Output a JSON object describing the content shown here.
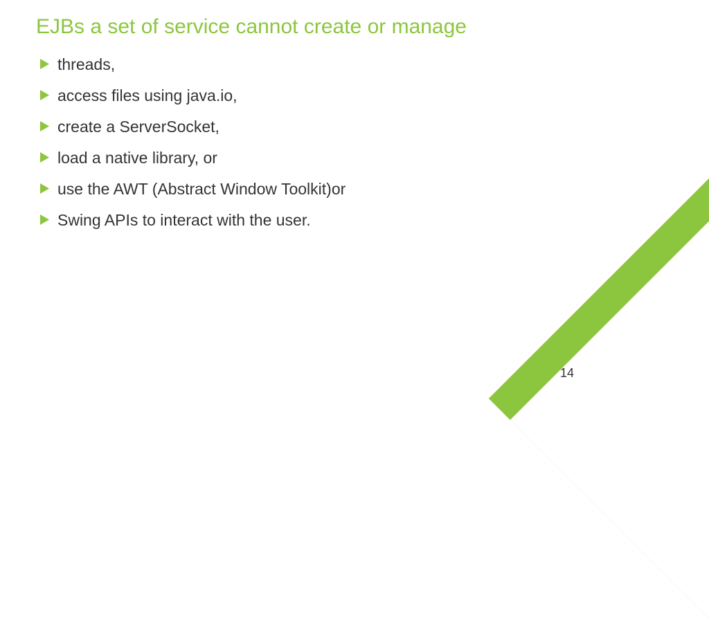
{
  "title": "EJBs a set of service cannot create or manage",
  "bullets": [
    "threads,",
    "access files using java.io,",
    "create a ServerSocket,",
    "load a native library, or",
    "use the AWT (Abstract Window Toolkit)or",
    "Swing APIs to interact with the user."
  ],
  "pageNumber": "14",
  "accentColor": "#8cc63f"
}
